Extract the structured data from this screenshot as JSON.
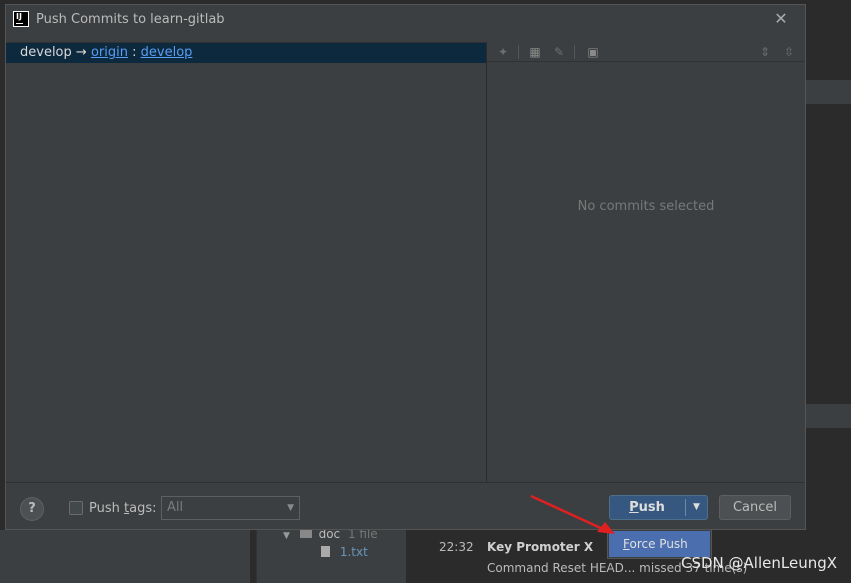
{
  "dialog": {
    "title": "Push Commits to learn-gitlab",
    "app_icon_text": "IJ",
    "close_glyph": "✕"
  },
  "repo": {
    "branch": "develop",
    "arrow": "→",
    "remote": "origin",
    "separator": ":",
    "target_branch": "develop"
  },
  "details": {
    "empty_text": "No commits selected"
  },
  "footer": {
    "help_label": "?",
    "push_tags_prefix": "Push ",
    "push_tags_mnemonic": "t",
    "push_tags_suffix": "ags:",
    "tags_select_value": "All",
    "push_mnemonic": "P",
    "push_rest": "ush",
    "cancel_label": "Cancel"
  },
  "menu": {
    "force_mnemonic": "F",
    "force_rest": "orce Push"
  },
  "background": {
    "tree_folder": "doc",
    "tree_folder_count": "1 file",
    "tree_file": "1.txt",
    "event_time": "22:32",
    "event_title": "Key Promoter X",
    "event_message": "Command Reset HEAD... missed 37 time(s)"
  },
  "watermark": "CSDN @AllenLeungX",
  "colors": {
    "accent_button": "#365880",
    "selection": "#0d293e",
    "menu_highlight": "#4b6eaf",
    "link": "#589df6",
    "annotation_arrow": "#e02020"
  }
}
